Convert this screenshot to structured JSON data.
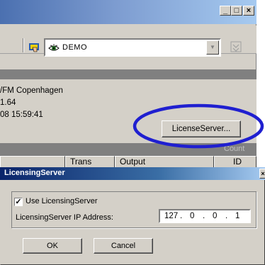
{
  "window": {
    "minimize": "_",
    "maximize": "□",
    "close": "×"
  },
  "toolbar": {
    "combo_value": "DEMO"
  },
  "info": {
    "line1": "/FM Copenhagen",
    "line2": "1.64",
    "line3": "08 15:59:41",
    "license_button": "LicenseServer..."
  },
  "grid": {
    "columns": [
      "Trans",
      "Output",
      "ID"
    ],
    "count_label": "Count"
  },
  "dialog": {
    "title": "LicensingServer",
    "close_glyph": "×",
    "use_checkbox_label": "Use LicensingServer",
    "use_checked": "✓",
    "ip_label": "LicensingServer IP Address:",
    "ip": [
      "127",
      "0",
      "0",
      "1"
    ],
    "ok_label": "OK",
    "cancel_label": "Cancel"
  },
  "colors": {
    "annotation_ellipse": "#1f1fd0"
  }
}
